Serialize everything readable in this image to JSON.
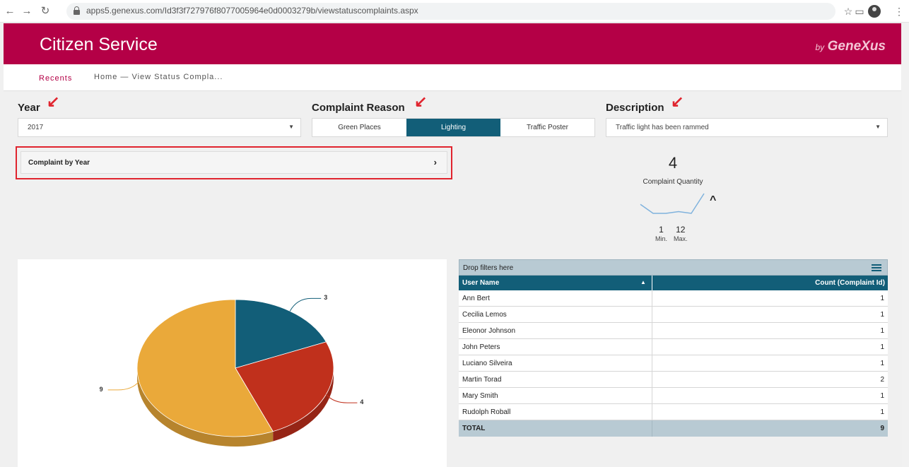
{
  "browser": {
    "url": "apps5.genexus.com/Id3f3f727976f8077005964e0d0003279b/viewstatuscomplaints.aspx"
  },
  "header": {
    "title": "Citizen Service",
    "brand_by": "by",
    "brand_name": "GeneXus",
    "color": "#b40046"
  },
  "subnav": {
    "recents": "Recents",
    "breadcrumb": "Home — View Status Compla..."
  },
  "filters": {
    "year": {
      "label": "Year",
      "value": "2017"
    },
    "reason": {
      "label": "Complaint Reason",
      "options": [
        "Green Places",
        "Lighting",
        "Traffic Poster"
      ],
      "selected": "Lighting"
    },
    "description": {
      "label": "Description",
      "value": "Traffic light has been rammed"
    }
  },
  "collapse": {
    "title": "Complaint by Year"
  },
  "kpi": {
    "value": "4",
    "label": "Complaint Quantity",
    "min": "1",
    "min_label": "Min.",
    "max": "12",
    "max_label": "Max.",
    "sparkline": [
      6,
      1,
      1,
      2,
      1,
      12
    ]
  },
  "chart_data": {
    "type": "pie",
    "slices": [
      {
        "label": "3",
        "value": 3,
        "color": "#125e78"
      },
      {
        "label": "4",
        "value": 4,
        "color": "#c0301c"
      },
      {
        "label": "9",
        "value": 9,
        "color": "#eaa93a"
      }
    ]
  },
  "pivot": {
    "drop_text": "Drop filters here",
    "col_user": "User Name",
    "col_count": "Count (Complaint Id)",
    "rows": [
      {
        "name": "Ann Bert",
        "count": "1"
      },
      {
        "name": "Cecilia Lemos",
        "count": "1"
      },
      {
        "name": "Eleonor Johnson",
        "count": "1"
      },
      {
        "name": "John Peters",
        "count": "1"
      },
      {
        "name": "Luciano Silveira",
        "count": "1"
      },
      {
        "name": "Martin Torad",
        "count": "2"
      },
      {
        "name": "Mary Smith",
        "count": "1"
      },
      {
        "name": "Rudolph Roball",
        "count": "1"
      }
    ],
    "total_label": "TOTAL",
    "total_value": "9"
  }
}
